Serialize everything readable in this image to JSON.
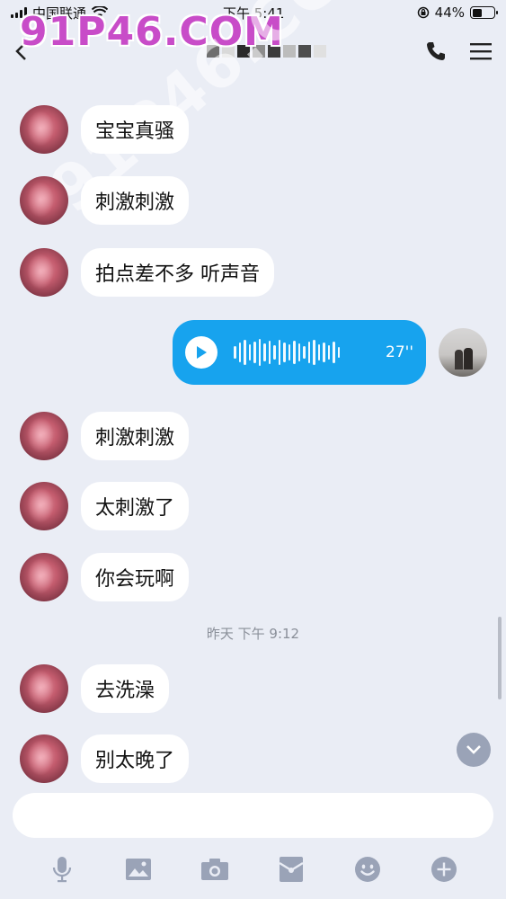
{
  "status_bar": {
    "carrier": "中国联通",
    "time": "下午 5:41",
    "battery": "44%",
    "battery_level": 0.44
  },
  "header": {
    "back_icon": "chevron-left-icon",
    "call_icon": "phone-icon",
    "menu_icon": "menu-icon"
  },
  "watermark": {
    "text": "91P46.COM"
  },
  "messages": [
    {
      "text": "宝宝真骚"
    },
    {
      "text": "刺激刺激"
    },
    {
      "text": "拍点差不多 听声音"
    },
    {
      "voice_duration": "27''"
    },
    {
      "text": "刺激刺激"
    },
    {
      "text": "太刺激了"
    },
    {
      "text": "你会玩啊"
    },
    {
      "text": "去洗澡"
    },
    {
      "text": "别太晚了"
    }
  ],
  "timestamp": "昨天 下午 9:12",
  "input": {
    "placeholder": ""
  },
  "toolbar": {
    "items": [
      "mic-icon",
      "image-icon",
      "camera-icon",
      "red-packet-icon",
      "emoji-icon",
      "plus-icon"
    ]
  },
  "colors": {
    "background": "#eaedf5",
    "voice_bubble": "#17a3ee",
    "icon_gray": "#9aa3b7"
  }
}
